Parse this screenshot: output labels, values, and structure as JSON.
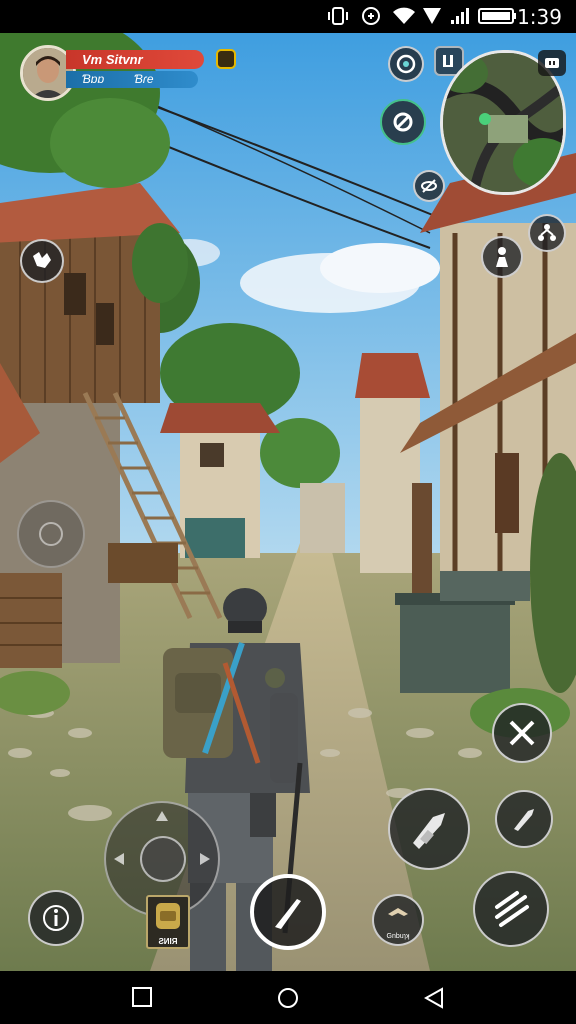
{
  "status_bar": {
    "time": "1:39",
    "icons": [
      "vibrate-icon",
      "data-saver-icon",
      "wifi-icon",
      "signal-icon",
      "signal-bars-icon",
      "battery-icon"
    ]
  },
  "player": {
    "name": "Vm Sitvnr",
    "stat_a": "Ɓɒɒ",
    "stat_b": "Ɓɾe"
  },
  "hud": {
    "item_slot_label": "ƧИIЯ",
    "pickup_label": "Gnbuɿʞ",
    "accent_red": "#d83b2f",
    "accent_blue": "#2580bf",
    "coin_color": "#e6b800"
  },
  "buttons": {
    "target_icon": "target-icon",
    "settings_icon": "gear-icon",
    "map_marker_icon": "map-marker-icon",
    "backpack_icon": "backpack-icon",
    "eye_icon": "eye-off-icon",
    "emote_icon": "emote-icon",
    "tree_icon": "skill-tree-icon",
    "crouch_icon": "crouch-icon",
    "melee_icon": "swords-icon",
    "weapon_icon": "weapon-icon",
    "knife_icon": "knife-icon",
    "slash_icon": "slash-icon",
    "info_icon": "info-icon",
    "pickup_icon": "hands-icon"
  },
  "nav": {
    "icons": [
      "back-square-icon",
      "home-circle-icon",
      "back-triangle-icon"
    ]
  }
}
